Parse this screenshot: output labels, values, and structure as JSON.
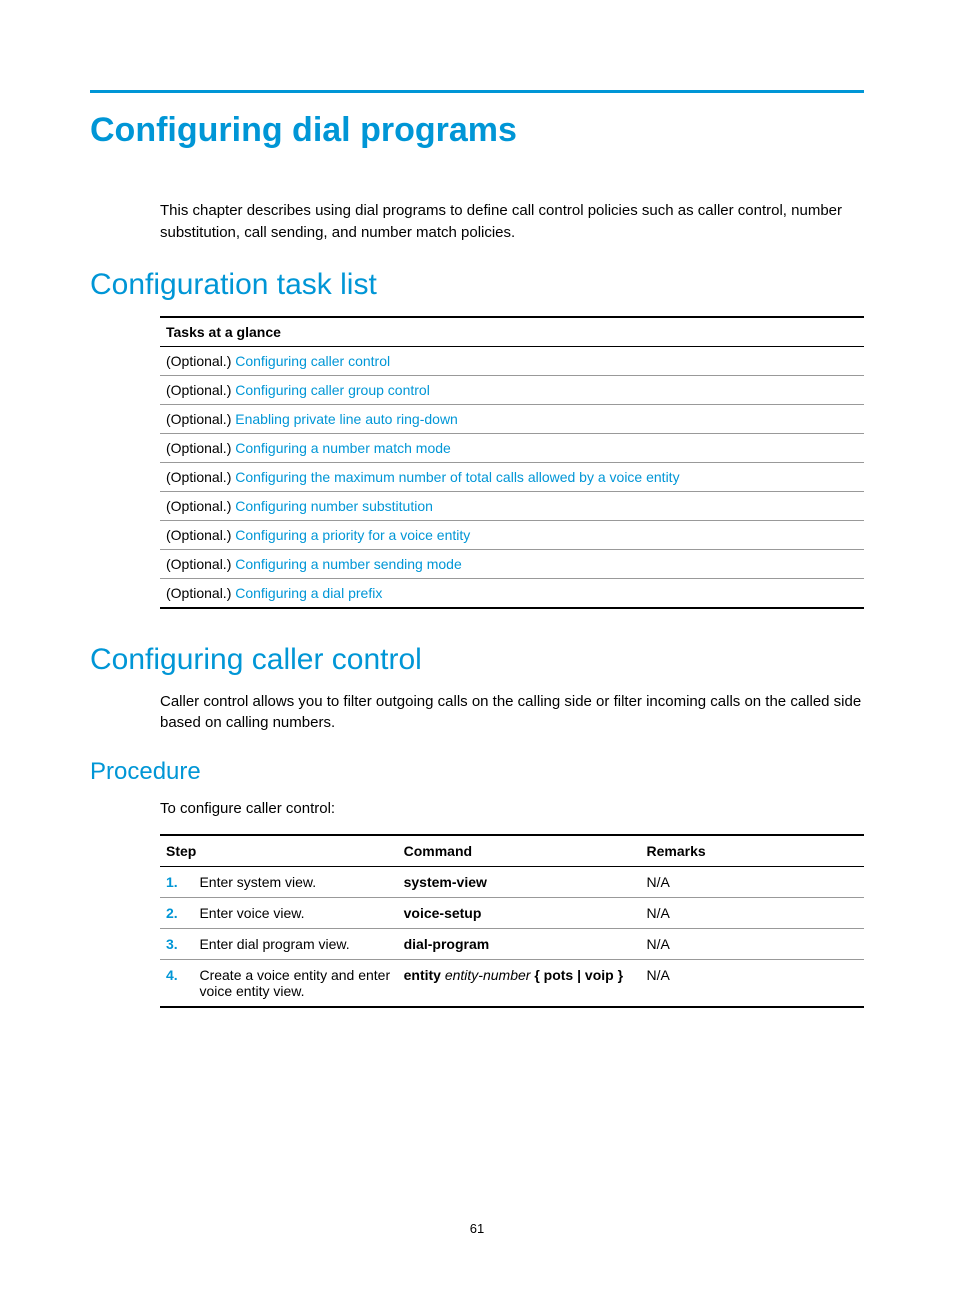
{
  "title": "Configuring dial programs",
  "intro": "This chapter describes using dial programs to define call control policies such as caller control, number substitution, call sending, and number match policies.",
  "sections": {
    "task_list_heading": "Configuration task list",
    "tasks_header": "Tasks at a glance",
    "optional_label": "(Optional.) ",
    "tasks": [
      "Configuring caller control",
      "Configuring caller group control",
      "Enabling private line auto ring-down",
      "Configuring a number match mode",
      "Configuring the maximum number of total calls allowed by a voice entity",
      "Configuring number substitution",
      "Configuring a priority for a voice entity",
      "Configuring a number sending mode",
      "Configuring a dial prefix"
    ],
    "caller_control_heading": "Configuring caller control",
    "caller_control_body": "Caller control allows you to filter outgoing calls on the calling side or filter incoming calls on the called side based on calling numbers.",
    "procedure_heading": "Procedure",
    "procedure_intro": "To configure caller control:",
    "proc_headers": {
      "step": "Step",
      "command": "Command",
      "remarks": "Remarks"
    },
    "steps": [
      {
        "num": "1.",
        "desc": "Enter system view.",
        "cmd_bold": "system-view",
        "cmd_rest": "",
        "remarks": "N/A"
      },
      {
        "num": "2.",
        "desc": "Enter voice view.",
        "cmd_bold": "voice-setup",
        "cmd_rest": "",
        "remarks": "N/A"
      },
      {
        "num": "3.",
        "desc": "Enter dial program view.",
        "cmd_bold": "dial-program",
        "cmd_rest": "",
        "remarks": "N/A"
      },
      {
        "num": "4.",
        "desc": "Create a voice entity and enter voice entity view.",
        "cmd_bold": "entity",
        "cmd_italic": " entity-number ",
        "cmd_tail_bold": "{ pots | voip }",
        "remarks": "N/A"
      }
    ]
  },
  "page_number": "61"
}
